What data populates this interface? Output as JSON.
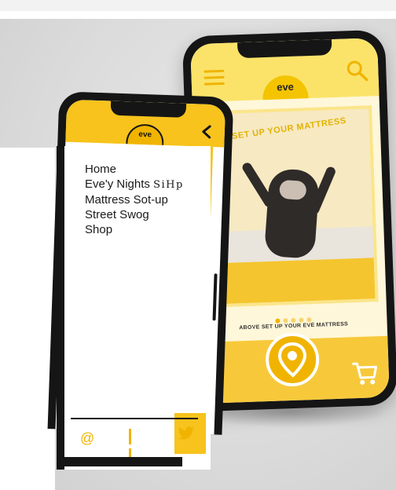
{
  "back_phone": {
    "logo_text": "eve",
    "hero_title": "SET UP YOUR MATTRESS",
    "caption": "ABOVE SET UP YOUR EVE MATTRESS",
    "carousel": {
      "total": 5,
      "active_index": 0
    }
  },
  "front_phone": {
    "logo_text": "eve",
    "back_glyph": "<"
  },
  "menu": {
    "items": [
      {
        "label": "Home"
      },
      {
        "label": "Eve'y Nights",
        "suffix": "SiHp"
      },
      {
        "label": "Mattress Sot-up"
      },
      {
        "label": "Street Swog"
      },
      {
        "label": "Shop"
      }
    ]
  },
  "social": {
    "at_glyph": "@",
    "icons": [
      "at-icon",
      "pause-icon",
      "twitter-icon"
    ]
  },
  "colors": {
    "brand_yellow": "#f7c31c",
    "accent_yellow": "#f0b400",
    "frame_black": "#151515"
  }
}
